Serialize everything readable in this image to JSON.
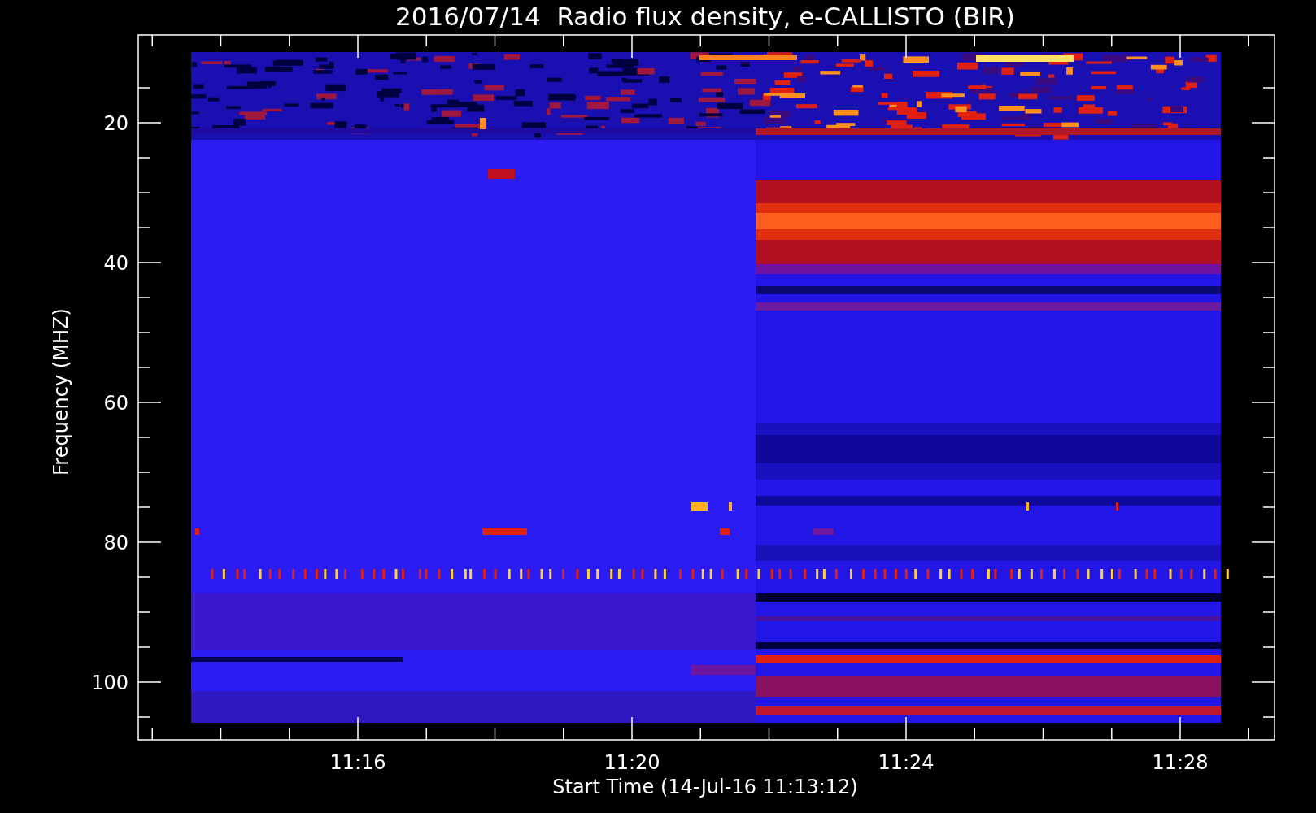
{
  "title": "2016/07/14  Radio flux density, e-CALLISTO (BIR)",
  "y_axis": {
    "label": "Frequency (MHZ)",
    "ticks": [
      "20",
      "40",
      "60",
      "80",
      "100"
    ]
  },
  "x_axis": {
    "label": "Start Time (14-Jul-16 11:13:12)",
    "ticks": [
      "11:16",
      "11:20",
      "11:24",
      "11:28"
    ]
  }
}
